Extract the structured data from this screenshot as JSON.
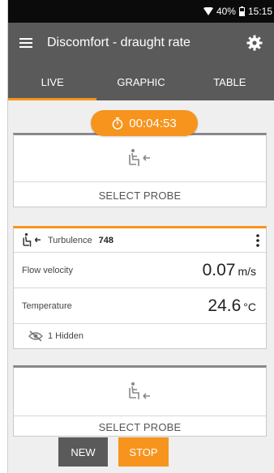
{
  "status": {
    "battery": "40%",
    "time": "15:15"
  },
  "appbar": {
    "title": "Discomfort - draught rate",
    "menu_icon": "hamburger-menu-icon",
    "settings_icon": "gear-icon"
  },
  "tabs": [
    {
      "label": "LIVE",
      "active": true
    },
    {
      "label": "GRAPHIC",
      "active": false
    },
    {
      "label": "TABLE",
      "active": false
    }
  ],
  "timer": {
    "value": "00:04:53",
    "icon": "stopwatch-icon"
  },
  "probe_slot_1": {
    "label": "SELECT PROBE",
    "icon": "seated-person-draught-icon"
  },
  "measurement_card": {
    "probe_name": "Turbulence",
    "probe_number": "748",
    "rows": [
      {
        "label": "Flow velocity",
        "value": "0.07",
        "unit": "m/s"
      },
      {
        "label": "Temperature",
        "value": "24.6",
        "unit": "°C"
      }
    ],
    "hidden_text": "1 Hidden"
  },
  "probe_slot_2": {
    "label": "SELECT PROBE",
    "icon": "seated-person-draught-icon"
  },
  "buttons": {
    "new": "NEW",
    "stop": "STOP"
  },
  "colors": {
    "accent": "#f7941d",
    "appbar": "#5a5a5a",
    "statusbar": "#0b0b0b"
  }
}
